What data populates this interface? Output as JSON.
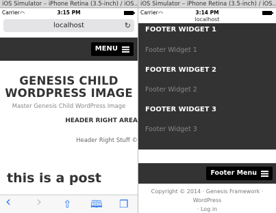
{
  "left": {
    "window_title": "iOS Simulator – iPhone Retina (3.5-inch) / iOS...",
    "status": {
      "carrier": "Carrier",
      "time": "3:15 PM"
    },
    "url": "localhost",
    "menu_label": "MENU",
    "site_title": "GENESIS CHILD WORDPRESS IMAGE",
    "site_description": "Master Genesis Child WordPress Image",
    "header_right_title": "HEADER RIGHT AREA",
    "header_right_text": "Header Right Stuff ©",
    "post_title": "this is a post"
  },
  "right": {
    "window_title": "iOS Simulator – iPhone Retina (3.5-inch) / iOS...",
    "status": {
      "carrier": "Carrier",
      "time": "3:14 PM"
    },
    "url": "localhost",
    "widgets": [
      {
        "title": "FOOTER WIDGET 1",
        "body": "Footer Widget 1"
      },
      {
        "title": "FOOTER WIDGET 2",
        "body": "Footer Widget 2"
      },
      {
        "title": "FOOTER WIDGET 3",
        "body": "Footer Widget 3"
      }
    ],
    "footer_menu_label": "Footer Menu",
    "credits": {
      "copyright": "Copyright © 2014 ·",
      "framework": "Genesis Framework",
      "sep1": "·",
      "wordpress": "WordPress",
      "sep2": "·",
      "login": "Log in"
    }
  },
  "icons": {
    "back": "‹",
    "forward": "›",
    "share": "⇧",
    "bookmarks": "📖",
    "tabs": "❐",
    "reload": "↻",
    "wifi": "◠"
  }
}
